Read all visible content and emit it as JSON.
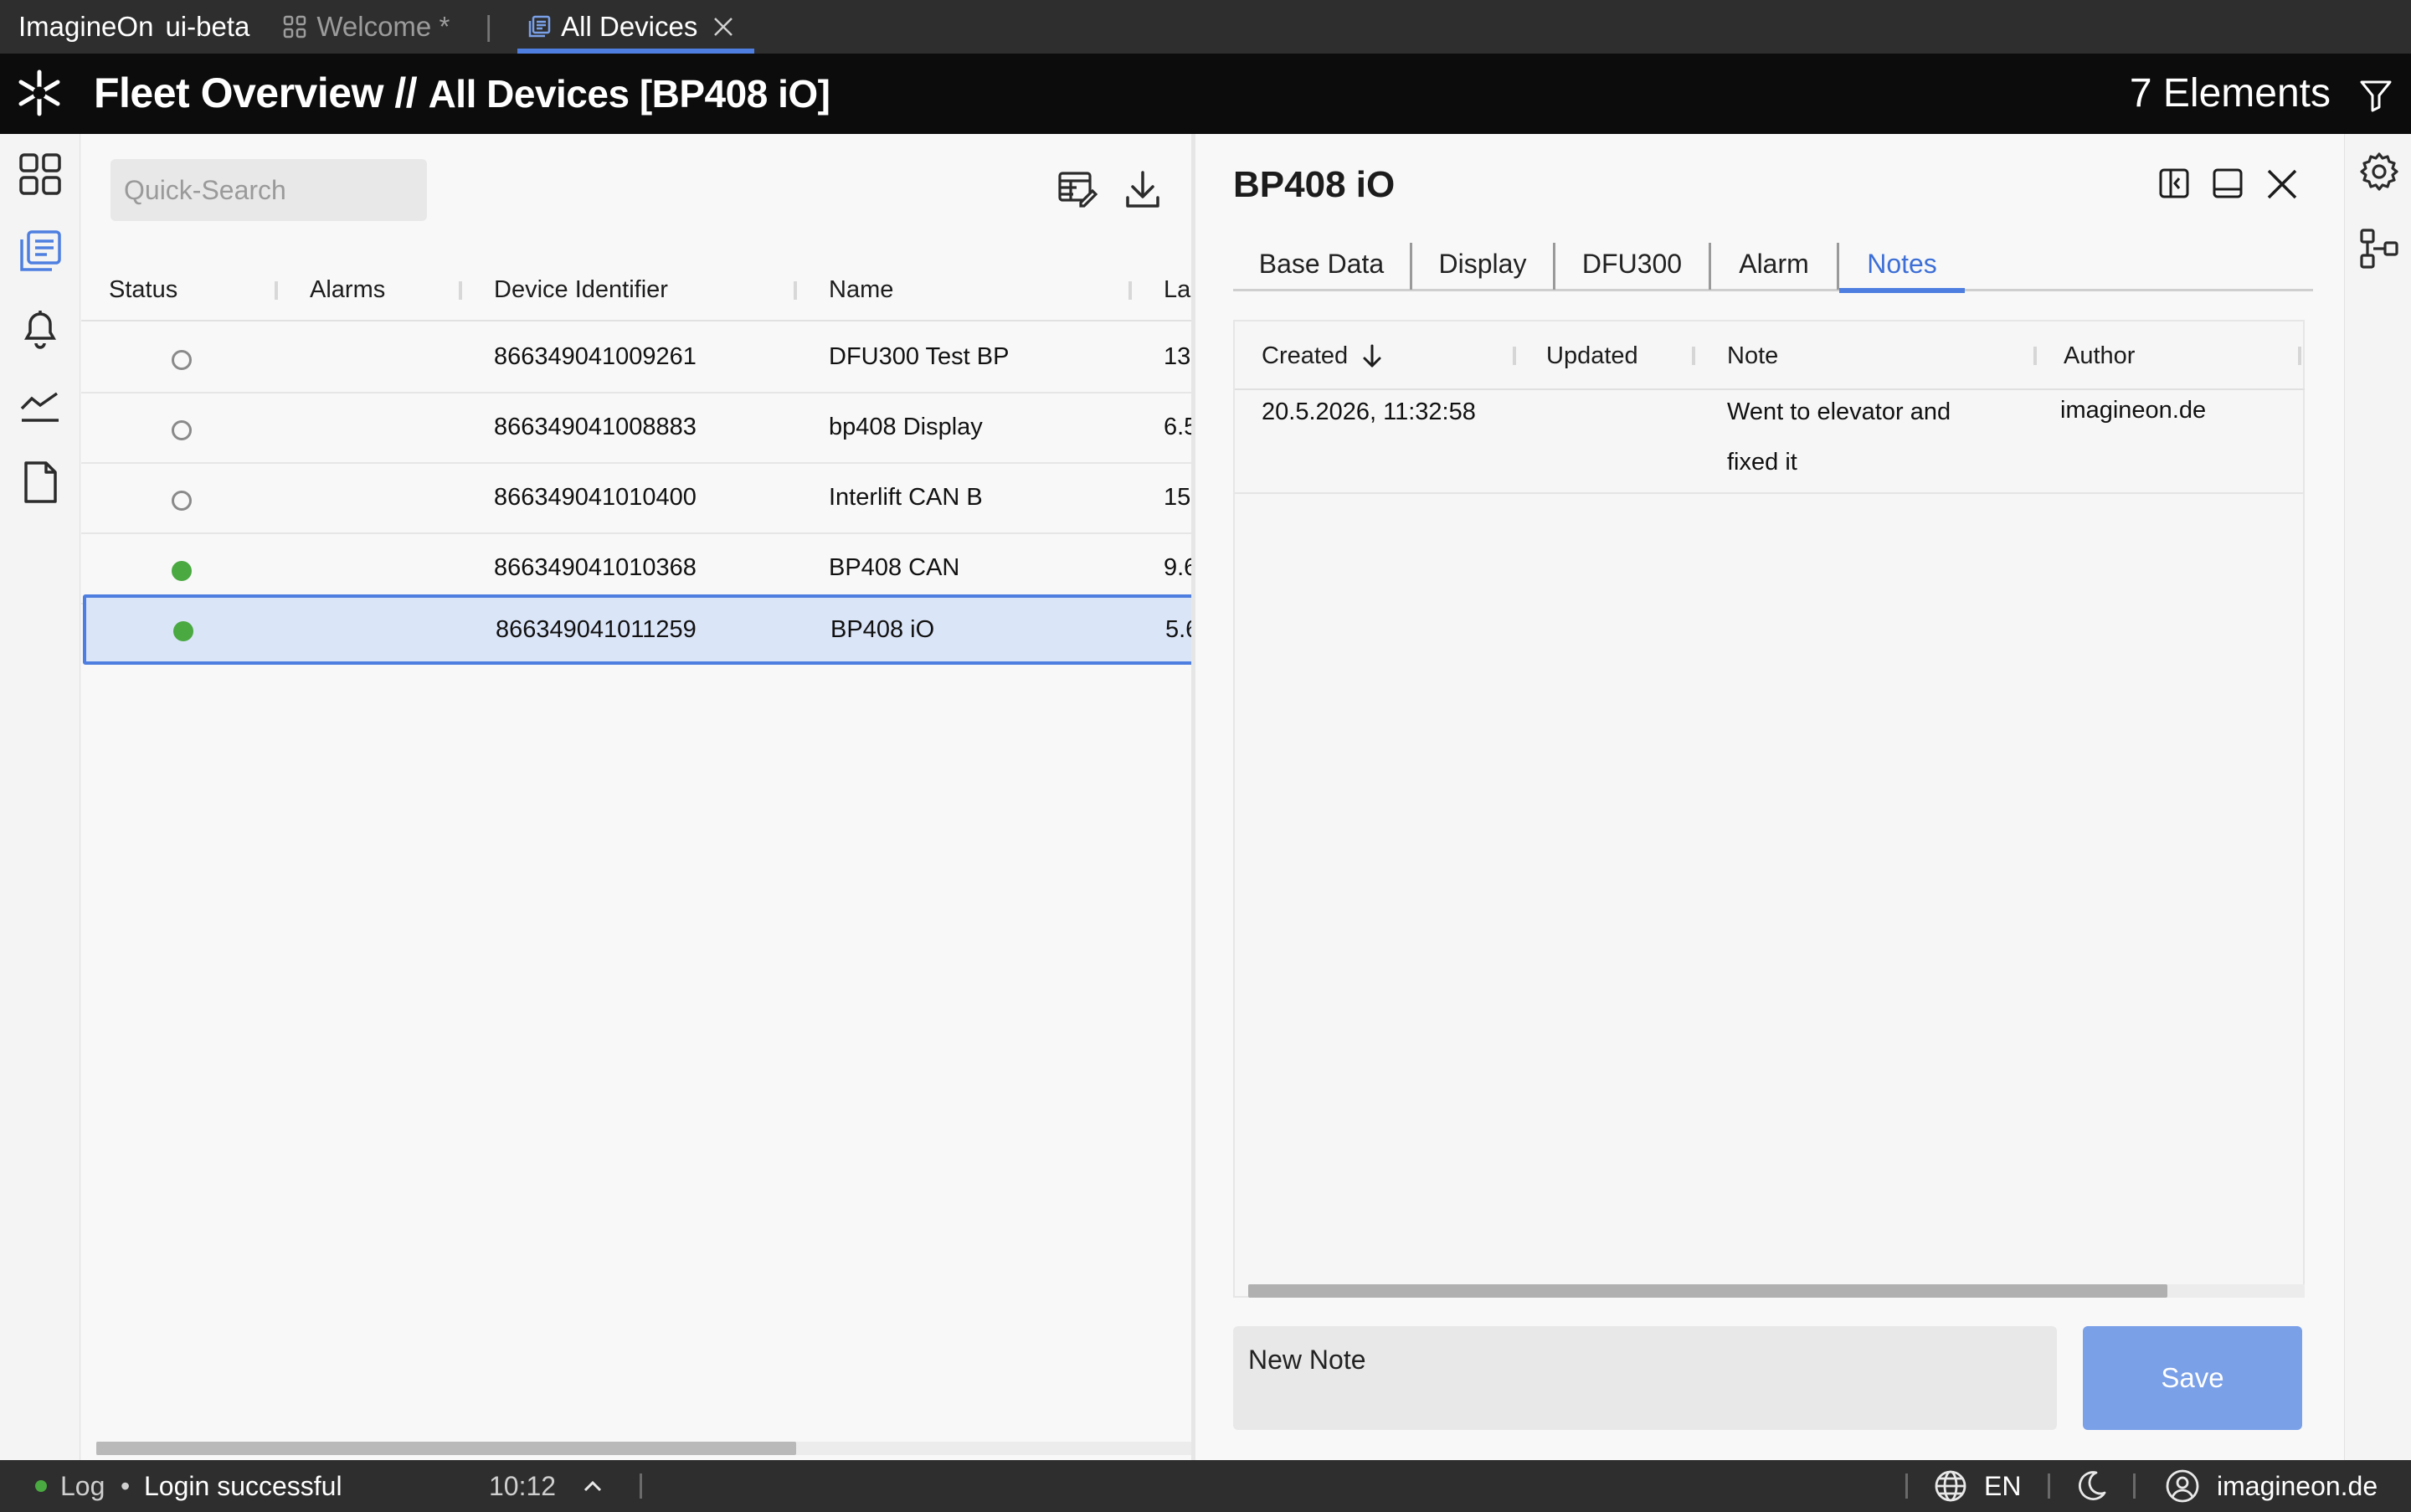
{
  "app": {
    "name": "ImagineOn",
    "env": "ui-beta"
  },
  "tabs": [
    {
      "label": "Welcome *",
      "active": false
    },
    {
      "label": "All Devices",
      "active": true
    }
  ],
  "header": {
    "title_main": "Fleet Overview",
    "title_separator": "//",
    "title_sub": "All Devices [BP408 iO]",
    "element_count": "7 Elements"
  },
  "left_rail": {
    "icons": [
      "dashboard-icon",
      "devices-list-icon",
      "alarms-bell-icon",
      "analytics-chart-icon",
      "document-icon"
    ],
    "active": "devices-list-icon"
  },
  "right_rail": {
    "icons": [
      "settings-gear-icon",
      "hierarchy-icon"
    ]
  },
  "device_list": {
    "search_placeholder": "Quick-Search",
    "columns": [
      "Status",
      "Alarms",
      "Device Identifier",
      "Name",
      "La"
    ],
    "rows": [
      {
        "status": "offline",
        "alarms": "",
        "identifier": "866349041009261",
        "name": "DFU300 Test BP",
        "last": "13."
      },
      {
        "status": "offline",
        "alarms": "",
        "identifier": "866349041008883",
        "name": "bp408 Display",
        "last": "6.5"
      },
      {
        "status": "offline",
        "alarms": "",
        "identifier": "866349041010400",
        "name": "Interlift CAN B",
        "last": "15."
      },
      {
        "status": "online",
        "alarms": "",
        "identifier": "866349041010368",
        "name": "BP408 CAN",
        "last": "9.6"
      },
      {
        "status": "online",
        "alarms": "",
        "identifier": "866349041011259",
        "name": "BP408 iO",
        "last": "5.6",
        "selected": true
      }
    ],
    "status_colors": {
      "online": "#4aa941",
      "offline": "#8a8a8a"
    }
  },
  "splitter": {
    "grip": "II"
  },
  "detail": {
    "title": "BP408 iO",
    "tabs": [
      "Base Data",
      "Display",
      "DFU300",
      "Alarm",
      "Notes"
    ],
    "active_tab": "Notes",
    "notes": {
      "columns": [
        "Created",
        "Updated",
        "Note",
        "Author"
      ],
      "sort_column": "Created",
      "sort_direction": "descending",
      "rows": [
        {
          "created": "20.5.2026, 11:32:58",
          "updated": "",
          "note_line1": "Went to elevator and",
          "note_line2": "fixed it",
          "author": "imagineon.de"
        }
      ]
    },
    "new_note_placeholder": "New Note",
    "save_label": "Save"
  },
  "statusbar": {
    "log_label": "Log",
    "bullet": "•",
    "message": "Login successful",
    "time": "10:12",
    "language": "EN",
    "user": "imagineon.de"
  },
  "colors": {
    "accent": "#4e7fe0",
    "save_button": "#7aa0e8",
    "selected_row": "#dbe5f8"
  }
}
